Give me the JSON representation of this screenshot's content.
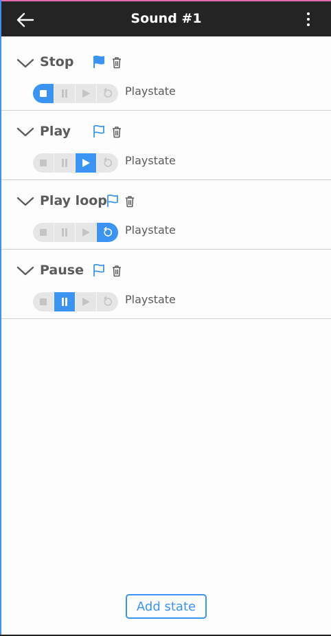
{
  "header": {
    "title": "Sound #1",
    "back_icon": "arrow-left-icon",
    "menu_icon": "more-vertical-icon"
  },
  "states": [
    {
      "name": "Stop",
      "flag_filled": true,
      "playstate_label": "Playstate",
      "active": "stop"
    },
    {
      "name": "Play",
      "flag_filled": false,
      "playstate_label": "Playstate",
      "active": "play"
    },
    {
      "name": "Play loop",
      "flag_filled": false,
      "playstate_label": "Playstate",
      "active": "loop"
    },
    {
      "name": "Pause",
      "flag_filled": false,
      "playstate_label": "Playstate",
      "active": "pause"
    }
  ],
  "playstate_options": [
    "stop",
    "pause",
    "play",
    "loop"
  ],
  "footer": {
    "add_state_label": "Add state"
  },
  "colors": {
    "accent": "#3b93f3",
    "header_bg": "#242424",
    "inactive_icon": "#c4c4c4",
    "text": "#5b5b5b"
  }
}
